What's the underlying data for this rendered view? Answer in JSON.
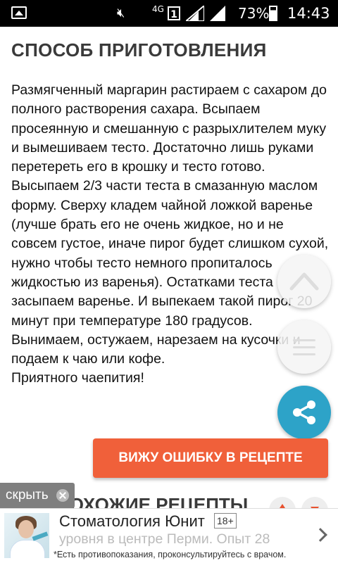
{
  "status_bar": {
    "network": "4G",
    "sim": "1",
    "battery": "73%",
    "time": "14:43"
  },
  "section": {
    "title": "СПОСОБ ПРИГОТОВЛЕНИЯ"
  },
  "recipe": {
    "paragraphs": [
      "Размягченный маргарин растираем с сахаром до полного растворения сахара. Всыпаем просеянную и смешанную с разрыхлителем муку и вымешиваем тесто. Достаточно лишь руками перетереть его в крошку и тесто готово.",
      "Высыпаем 2/3 части теста в смазанную маслом форму. Сверху кладем чайной ложкой варенье (лучше брать его не очень жидкое, но и не совсем густое, иначе пирог будет слишком сухой, нужно чтобы тесто немного пропиталось жидкостью из варенья). Остатками теста засыпаем варенье. И выпекаем такой пирог 20 минут при температуре 180 градусов.",
      "Вынимаем, остужаем, нарезаем на кусочки и подаем к чаю или кофе.",
      "Приятного чаепития!"
    ]
  },
  "buttons": {
    "report_error": "ВИЖУ ОШИБКУ В РЕЦЕПТЕ",
    "hide": "скрыть"
  },
  "similar": {
    "title": "ПОХОЖИЕ РЕЦЕПТЫ"
  },
  "ad": {
    "title": "Стоматология Юнит",
    "age": "18+",
    "text": "уровня в центре Перми. Опыт 28",
    "disclaimer": "*Есть противопоказания, проконсультируйтесь с врачом."
  },
  "colors": {
    "accent": "#f0603a",
    "share": "#2da3c8"
  }
}
